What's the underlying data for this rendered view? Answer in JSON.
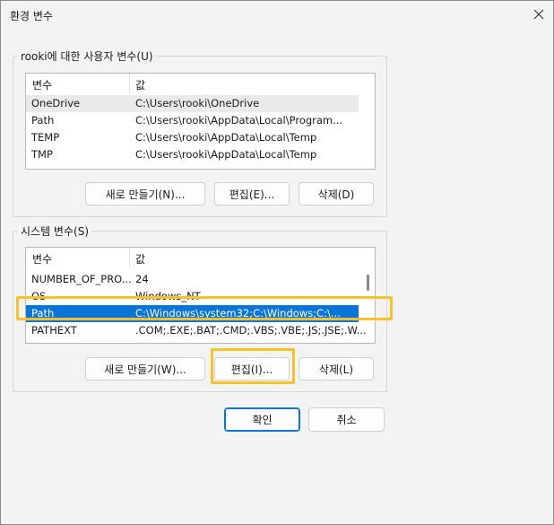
{
  "window": {
    "title": "환경 변수"
  },
  "user_vars": {
    "legend": "rooki에 대한 사용자 변수(U)",
    "columns": [
      "변수",
      "값"
    ],
    "rows": [
      {
        "name": "OneDrive",
        "value": "C:\\Users\\rooki\\OneDrive"
      },
      {
        "name": "Path",
        "value": "C:\\Users\\rooki\\AppData\\Local\\Program..."
      },
      {
        "name": "TEMP",
        "value": "C:\\Users\\rooki\\AppData\\Local\\Temp"
      },
      {
        "name": "TMP",
        "value": "C:\\Users\\rooki\\AppData\\Local\\Temp"
      }
    ],
    "buttons": {
      "new": "새로 만들기(N)...",
      "edit": "편집(E)...",
      "delete": "삭제(D)"
    }
  },
  "system_vars": {
    "legend": "시스템 변수(S)",
    "columns": [
      "변수",
      "값"
    ],
    "rows": [
      {
        "name": "NUMBER_OF_PRO...",
        "value": "24"
      },
      {
        "name": "OS",
        "value": "Windows_NT"
      },
      {
        "name": "Path",
        "value": "C:\\Windows\\system32;C:\\Windows;C:\\..."
      },
      {
        "name": "PATHEXT",
        "value": ".COM;.EXE;.BAT;.CMD;.VBS;.VBE;.JS;.JSE;.W..."
      }
    ],
    "selected_row": "Path",
    "buttons": {
      "new": "새로 만들기(W)...",
      "edit": "편집(I)...",
      "delete": "삭제(L)"
    }
  },
  "footer": {
    "ok": "확인",
    "cancel": "취소"
  },
  "colors": {
    "selection": "#0a74da",
    "highlight": "#f6c12a"
  }
}
